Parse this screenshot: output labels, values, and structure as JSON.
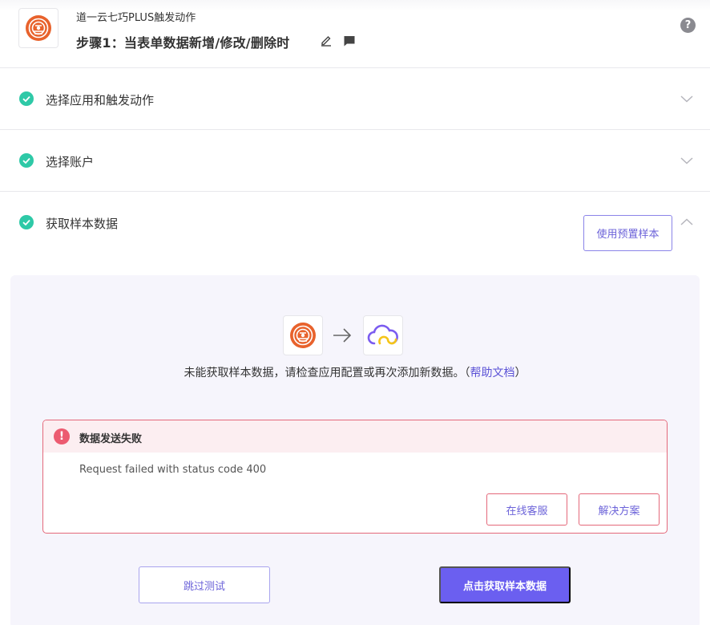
{
  "header": {
    "app_name": "道一云七巧PLUS触发动作",
    "step_title": "步骤1：当表单数据新增/修改/删除时",
    "help_glyph": "?"
  },
  "sections": [
    {
      "label": "选择应用和触发动作",
      "status": "completed",
      "expanded": false
    },
    {
      "label": "选择账户",
      "status": "completed",
      "expanded": false
    },
    {
      "label": "获取样本数据",
      "status": "completed",
      "expanded": true
    }
  ],
  "sample": {
    "preset_button": "使用预置样本",
    "notice_text": "未能获取样本数据，请检查应用配置或再次添加新数据。（",
    "notice_link": "帮助文档",
    "notice_end": "）",
    "error": {
      "icon_glyph": "!",
      "title": "数据发送失败",
      "message": "Request failed with status code 400",
      "support_button": "在线客服",
      "solution_button": "解决方案"
    },
    "skip_button": "跳过测试",
    "fetch_button": "点击获取样本数据"
  },
  "colors": {
    "accent": "#6b5ff0",
    "success": "#2ec9a7",
    "error": "#e4687a",
    "brand_orange": "#e8622c"
  }
}
